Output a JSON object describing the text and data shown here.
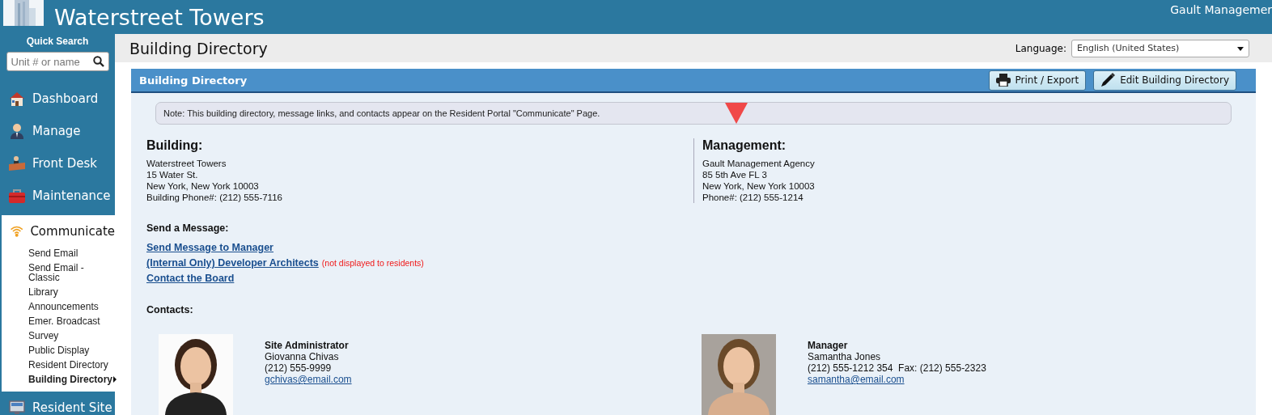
{
  "header": {
    "title": "Waterstreet Towers",
    "account": "Gault Managemer"
  },
  "quick_search": {
    "label": "Quick Search",
    "placeholder": "Unit # or name"
  },
  "nav": [
    {
      "label": "Dashboard",
      "expanded": false
    },
    {
      "label": "Manage",
      "expanded": false
    },
    {
      "label": "Front Desk",
      "expanded": false
    },
    {
      "label": "Maintenance",
      "expanded": false
    },
    {
      "label": "Communicate",
      "expanded": true,
      "children": [
        {
          "label": "Send Email",
          "selected": false
        },
        {
          "label": "Send Email - Classic",
          "selected": false
        },
        {
          "label": "Library",
          "selected": false
        },
        {
          "label": "Announcements",
          "selected": false
        },
        {
          "label": "Emer. Broadcast",
          "selected": false
        },
        {
          "label": "Survey",
          "selected": false
        },
        {
          "label": "Public Display",
          "selected": false
        },
        {
          "label": "Resident Directory",
          "selected": false
        },
        {
          "label": "Building Directory",
          "selected": true
        }
      ]
    },
    {
      "label": "Resident Site",
      "expanded": false
    }
  ],
  "page_title": "Building Directory",
  "language": {
    "label": "Language:",
    "value": "English (United States)"
  },
  "panel": {
    "title": "Building Directory",
    "buttons": [
      "Print / Export",
      "Edit Building Directory"
    ]
  },
  "note": "Note: This building directory, message links, and contacts appear on the Resident Portal \"Communicate\" Page.",
  "building": {
    "heading": "Building:",
    "lines": [
      "Waterstreet Towers",
      "15 Water St.",
      "New York, New York 10003",
      "Building Phone#: (212) 555-7116"
    ]
  },
  "management": {
    "heading": "Management:",
    "lines": [
      "Gault Management Agency",
      "85 5th Ave FL 3",
      "New York, New York 10003",
      "Phone#: (212) 555-1214"
    ]
  },
  "send_message": {
    "heading": "Send a Message:",
    "links": [
      {
        "label": "Send Message to Manager"
      },
      {
        "label": "(Internal Only) Developer Architects",
        "note": "(not displayed to residents)"
      },
      {
        "label": "Contact the Board"
      }
    ]
  },
  "contacts": {
    "heading": "Contacts:",
    "items": [
      {
        "role": "Site Administrator",
        "name": "Giovanna Chivas",
        "phone": "(212) 555-9999",
        "email": "gchivas@email.com"
      },
      {
        "role": "Manager",
        "name": "Samantha Jones",
        "phone": "(212) 555-1212 354  Fax: (212) 555-2323",
        "email": "samantha@email.com"
      }
    ]
  }
}
